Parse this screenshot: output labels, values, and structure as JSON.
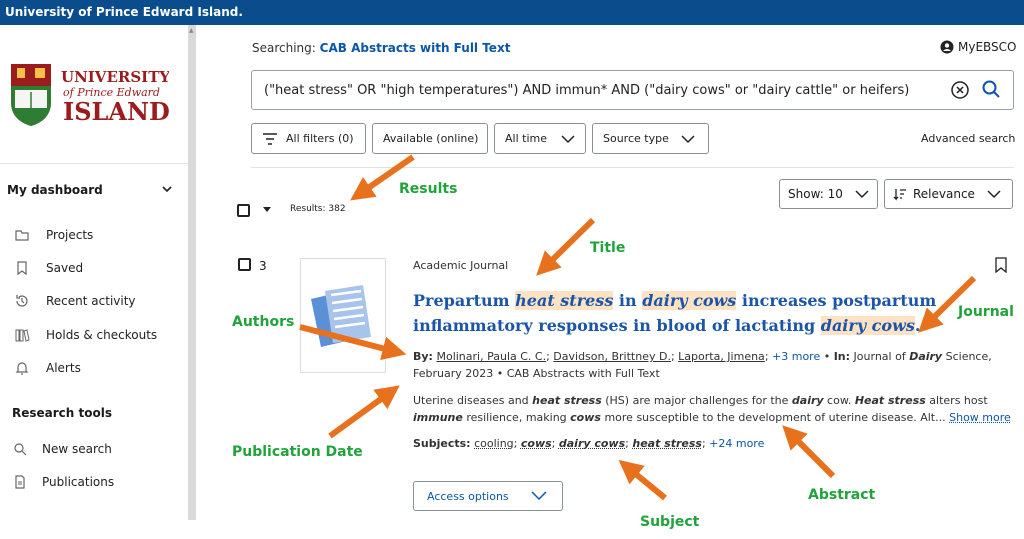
{
  "topbar": {
    "title": "University of Prince Edward Island."
  },
  "logo": {
    "line1": "UNIVERSITY",
    "line2": "of Prince Edward",
    "line3": "ISLAND"
  },
  "sidebar": {
    "dashboard_label": "My dashboard",
    "items": [
      {
        "label": "Projects",
        "icon": "folder-icon"
      },
      {
        "label": "Saved",
        "icon": "bookmark-icon"
      },
      {
        "label": "Recent activity",
        "icon": "history-icon"
      },
      {
        "label": "Holds & checkouts",
        "icon": "books-icon"
      },
      {
        "label": "Alerts",
        "icon": "bell-icon"
      }
    ],
    "research_label": "Research tools",
    "tools": [
      {
        "label": "New search",
        "icon": "search-icon"
      },
      {
        "label": "Publications",
        "icon": "document-icon"
      }
    ]
  },
  "header": {
    "searching_label": "Searching:",
    "database": "CAB Abstracts with Full Text",
    "myebsco": "MyEBSCO"
  },
  "search": {
    "query": "(\"heat stress\" OR \"high temperatures\") AND immun* AND (\"dairy cows\" or \"dairy cattle\" or heifers)"
  },
  "filters": {
    "all_filters": "All filters (0)",
    "available": "Available (online)",
    "all_time": "All time",
    "source_type": "Source type",
    "advanced": "Advanced search"
  },
  "results": {
    "count_label": "Results: 382",
    "show_label": "Show: 10",
    "sort_label": "Relevance"
  },
  "record": {
    "number": "3",
    "pub_type": "Academic Journal",
    "title_parts": [
      "Prepartum ",
      "heat stress",
      " in ",
      "dairy cows",
      " increases postpartum inflammatory responses in blood of lactating ",
      "dairy cows",
      "."
    ],
    "by_label": "By:",
    "authors": [
      "Molinari, Paula C. C.",
      "Davidson, Brittney D.",
      "Laporta, Jimena"
    ],
    "more_authors": "+3 more",
    "in_label": "In:",
    "journal_pre": "Journal of ",
    "journal_em": "Dairy",
    "journal_post": " Science,",
    "date_source": "February 2023 • CAB Abstracts with Full Text",
    "abstract_parts": [
      "Uterine diseases and ",
      "heat stress",
      " (HS) are major challenges for the ",
      "dairy",
      " cow. ",
      "Heat stress",
      " alters host ",
      "immune",
      " resilience, making ",
      "cows",
      " more susceptible to the development of uterine disease. Alt... "
    ],
    "show_more": "Show more",
    "subjects_label": "Subjects:",
    "subjects": [
      "cooling",
      "cows",
      "dairy cows",
      "heat stress"
    ],
    "subjects_more": "+24 more",
    "access_label": "Access options"
  },
  "annotations": {
    "results": "Results",
    "title": "Title",
    "authors": "Authors",
    "journal": "Journal",
    "publication_date": "Publication Date",
    "abstract": "Abstract",
    "subject": "Subject"
  },
  "colors": {
    "topbar": "#0b4c8c",
    "link": "#1a55a8",
    "highlight": "#fde2c4",
    "annotation_text": "#21a33b",
    "annotation_arrow": "#e8711d"
  }
}
